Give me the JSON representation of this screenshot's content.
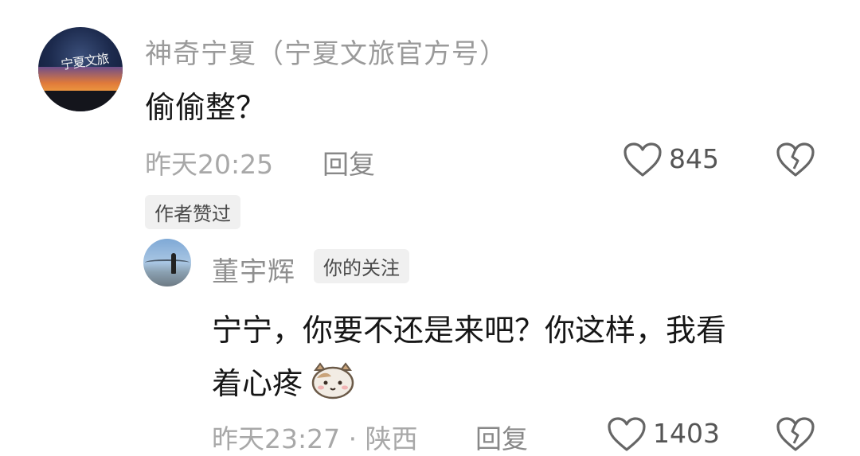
{
  "comment": {
    "username": "神奇宁夏（宁夏文旅官方号）",
    "avatar_text": "宁夏文旅",
    "text": "偷偷整？",
    "time": "昨天20:25",
    "reply_label": "回复",
    "like_count": "845",
    "author_badge": "作者赞过"
  },
  "reply": {
    "username": "董宇辉",
    "follow_badge": "你的关注",
    "text_line1": "宁宁，你要不还是来吧？你这样，我看",
    "text_line2": "着心疼",
    "time_location": "昨天23:27 · 陕西",
    "reply_label": "回复",
    "like_count": "1403"
  },
  "icons": [
    "heart-outline-icon",
    "broken-heart-icon",
    "cat-emoji-icon"
  ]
}
